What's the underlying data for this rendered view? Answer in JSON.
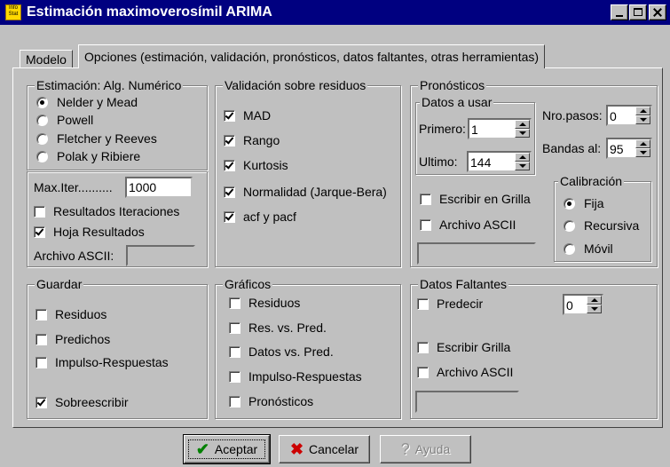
{
  "window": {
    "title": "Estimación maximoverosímil ARIMA",
    "icon_text": "Info Stat"
  },
  "tabs": [
    {
      "label": "Modelo"
    },
    {
      "label": "Opciones (estimación, validación, pronósticos, datos faltantes, otras herramientas)"
    }
  ],
  "estimacion": {
    "title": "Estimación: Alg. Numérico",
    "options": [
      "Nelder y Mead",
      "Powell",
      "Fletcher y Reeves",
      "Polak y Ribiere"
    ],
    "selected": "Nelder y Mead",
    "max_iter_label": "Max.Iter..........",
    "max_iter_value": "1000",
    "resultados_iteraciones": "Resultados Iteraciones",
    "hoja_resultados": "Hoja Resultados",
    "archivo_ascii": "Archivo ASCII:"
  },
  "validacion": {
    "title": "Validación sobre residuos",
    "items": [
      "MAD",
      "Rango",
      "Kurtosis",
      "Normalidad (Jarque-Bera)",
      "acf y pacf"
    ]
  },
  "pronosticos": {
    "title": "Pronósticos",
    "datos_a_usar": "Datos a usar",
    "primero_label": "Primero:",
    "primero_value": "1",
    "ultimo_label": "Ultimo:",
    "ultimo_value": "144",
    "nro_pasos_label": "Nro.pasos:",
    "nro_pasos_value": "0",
    "bandas_label": "Bandas al:",
    "bandas_value": "95",
    "escribir_grilla": "Escribir en Grilla",
    "archivo_ascii": "Archivo ASCII",
    "calibracion": {
      "title": "Calibración",
      "options": [
        "Fija",
        "Recursiva",
        "Móvil"
      ],
      "selected": "Fija"
    }
  },
  "guardar": {
    "title": "Guardar",
    "items": [
      "Residuos",
      "Predichos",
      "Impulso-Respuestas",
      "Sobreescribir"
    ]
  },
  "graficos": {
    "title": "Gráficos",
    "items": [
      "Residuos",
      "Res. vs. Pred.",
      "Datos vs. Pred.",
      "Impulso-Respuestas",
      "Pronósticos"
    ]
  },
  "datos_faltantes": {
    "title": "Datos Faltantes",
    "predecir": "Predecir",
    "predecir_value": "0",
    "escribir_grilla": "Escribir Grilla",
    "archivo_ascii": "Archivo ASCII"
  },
  "buttons": {
    "aceptar": "Aceptar",
    "cancelar": "Cancelar",
    "ayuda": "Ayuda"
  },
  "colors": {
    "title_bar": "#000080",
    "face": "#c0c0c0",
    "accept_icon": "#008000",
    "cancel_icon": "#cc0000"
  }
}
